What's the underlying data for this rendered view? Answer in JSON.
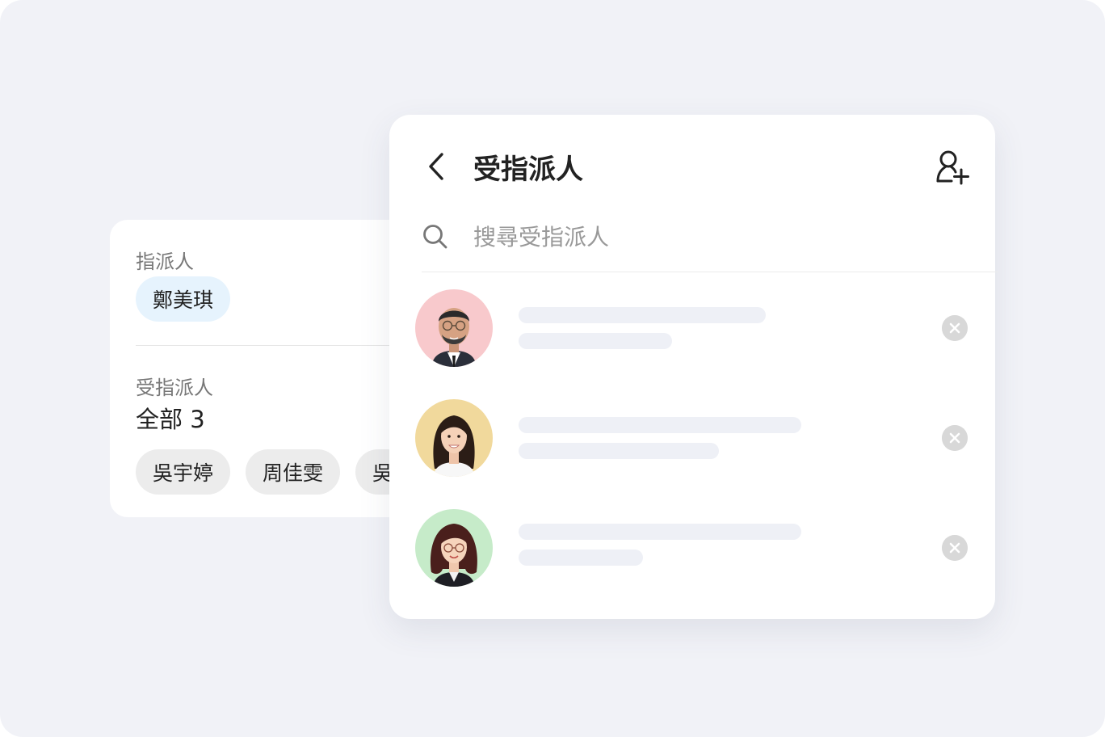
{
  "assigner_section": {
    "label": "指派人",
    "person": "鄭美琪"
  },
  "assignee_section": {
    "label": "受指派人",
    "count_text": "全部 3",
    "chips": [
      "吳宇婷",
      "周佳雯",
      "吳"
    ]
  },
  "panel": {
    "title": "受指派人",
    "search_placeholder": "搜尋受指派人",
    "assignees": [
      {
        "avatar_bg": "#f8c9cc",
        "icon": "avatar-man-glasses"
      },
      {
        "avatar_bg": "#f1d99c",
        "icon": "avatar-woman-long-hair"
      },
      {
        "avatar_bg": "#c6ebc9",
        "icon": "avatar-woman-glasses"
      }
    ]
  },
  "colors": {
    "background": "#f1f2f7",
    "assigner_chip": "#e6f3fd",
    "assignee_chip": "#ececec",
    "placeholder_bar": "#eef0f6",
    "remove_button": "#d8d8d8"
  }
}
